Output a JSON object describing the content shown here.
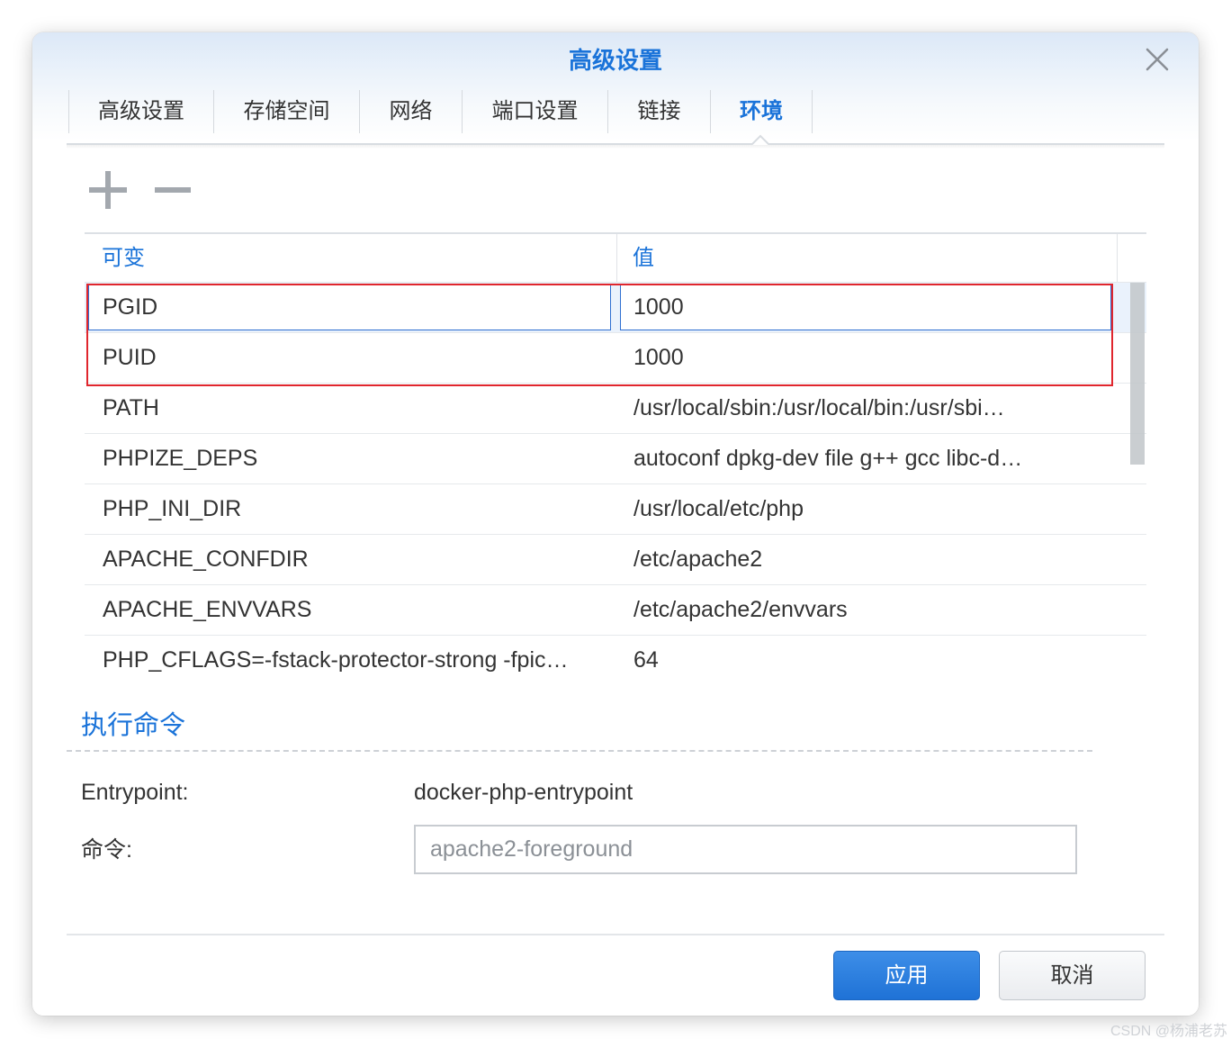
{
  "window": {
    "title": "高级设置"
  },
  "icons": {
    "close": "close-icon",
    "add": "plus-icon",
    "remove": "minus-icon"
  },
  "tabs": [
    {
      "label": "高级设置",
      "active": false
    },
    {
      "label": "存储空间",
      "active": false
    },
    {
      "label": "网络",
      "active": false
    },
    {
      "label": "端口设置",
      "active": false
    },
    {
      "label": "链接",
      "active": false
    },
    {
      "label": "环境",
      "active": true
    }
  ],
  "env_table": {
    "columns": [
      "可变",
      "值"
    ],
    "rows": [
      {
        "variable": "PGID",
        "value": "1000",
        "editing": true,
        "highlighted": true
      },
      {
        "variable": "PUID",
        "value": "1000",
        "editing": false,
        "highlighted": true
      },
      {
        "variable": "PATH",
        "value": "/usr/local/sbin:/usr/local/bin:/usr/sbi…",
        "editing": false
      },
      {
        "variable": "PHPIZE_DEPS",
        "value": "autoconf dpkg-dev file g++ gcc libc-d…",
        "editing": false
      },
      {
        "variable": "PHP_INI_DIR",
        "value": "/usr/local/etc/php",
        "editing": false
      },
      {
        "variable": "APACHE_CONFDIR",
        "value": "/etc/apache2",
        "editing": false
      },
      {
        "variable": "APACHE_ENVVARS",
        "value": "/etc/apache2/envvars",
        "editing": false
      },
      {
        "variable": "PHP_CFLAGS=-fstack-protector-strong -fpic…",
        "value": "64",
        "editing": false
      }
    ]
  },
  "command_section": {
    "title": "执行命令",
    "entrypoint_label": "Entrypoint:",
    "entrypoint_value": "docker-php-entrypoint",
    "command_label": "命令:",
    "command_value": "apache2-foreground"
  },
  "footer": {
    "apply_label": "应用",
    "cancel_label": "取消"
  },
  "watermark": "CSDN @杨浦老苏",
  "colors": {
    "accent": "#1a73d9",
    "text": "#333333",
    "muted_text": "#8b9096",
    "primary_button": "#2a7fe0",
    "editing_outline": "#2e6fd1",
    "annotation": "#e0262d"
  }
}
